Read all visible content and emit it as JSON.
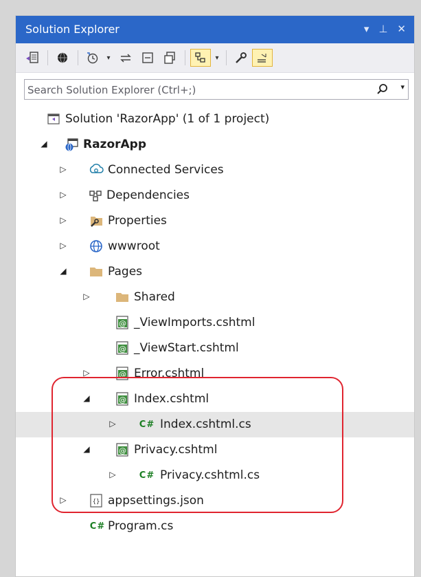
{
  "panel": {
    "title": "Solution Explorer",
    "actions": [
      "▾",
      "⊥",
      "✕"
    ]
  },
  "search": {
    "placeholder": "Search Solution Explorer (Ctrl+;)"
  },
  "tree": [
    {
      "label": "Solution 'RazorApp' (1 of 1 project)",
      "icon": "solution-icon"
    },
    {
      "label": "RazorApp",
      "icon": "web-project-icon"
    },
    {
      "label": "Connected Services",
      "icon": "connected-services-icon"
    },
    {
      "label": "Dependencies",
      "icon": "dependencies-icon"
    },
    {
      "label": "Properties",
      "icon": "properties-icon"
    },
    {
      "label": "wwwroot",
      "icon": "globe-icon"
    },
    {
      "label": "Pages",
      "icon": "folder-icon"
    },
    {
      "label": "Shared",
      "icon": "folder-icon"
    },
    {
      "label": "_ViewImports.cshtml",
      "icon": "razor-file-icon"
    },
    {
      "label": "_ViewStart.cshtml",
      "icon": "razor-file-icon"
    },
    {
      "label": "Error.cshtml",
      "icon": "razor-file-icon"
    },
    {
      "label": "Index.cshtml",
      "icon": "razor-file-icon"
    },
    {
      "label": "Index.cshtml.cs",
      "icon": "csharp-file-icon"
    },
    {
      "label": "Privacy.cshtml",
      "icon": "razor-file-icon"
    },
    {
      "label": "Privacy.cshtml.cs",
      "icon": "csharp-file-icon"
    },
    {
      "label": "appsettings.json",
      "icon": "json-file-icon"
    },
    {
      "label": "Program.cs",
      "icon": "csharp-file-icon"
    }
  ],
  "csharp_badge": "C#",
  "colors": {
    "titlebar": "#2b67c8",
    "highlight": "#e0242f",
    "folder": "#dcb67a",
    "razor": "#3f8f3f"
  }
}
